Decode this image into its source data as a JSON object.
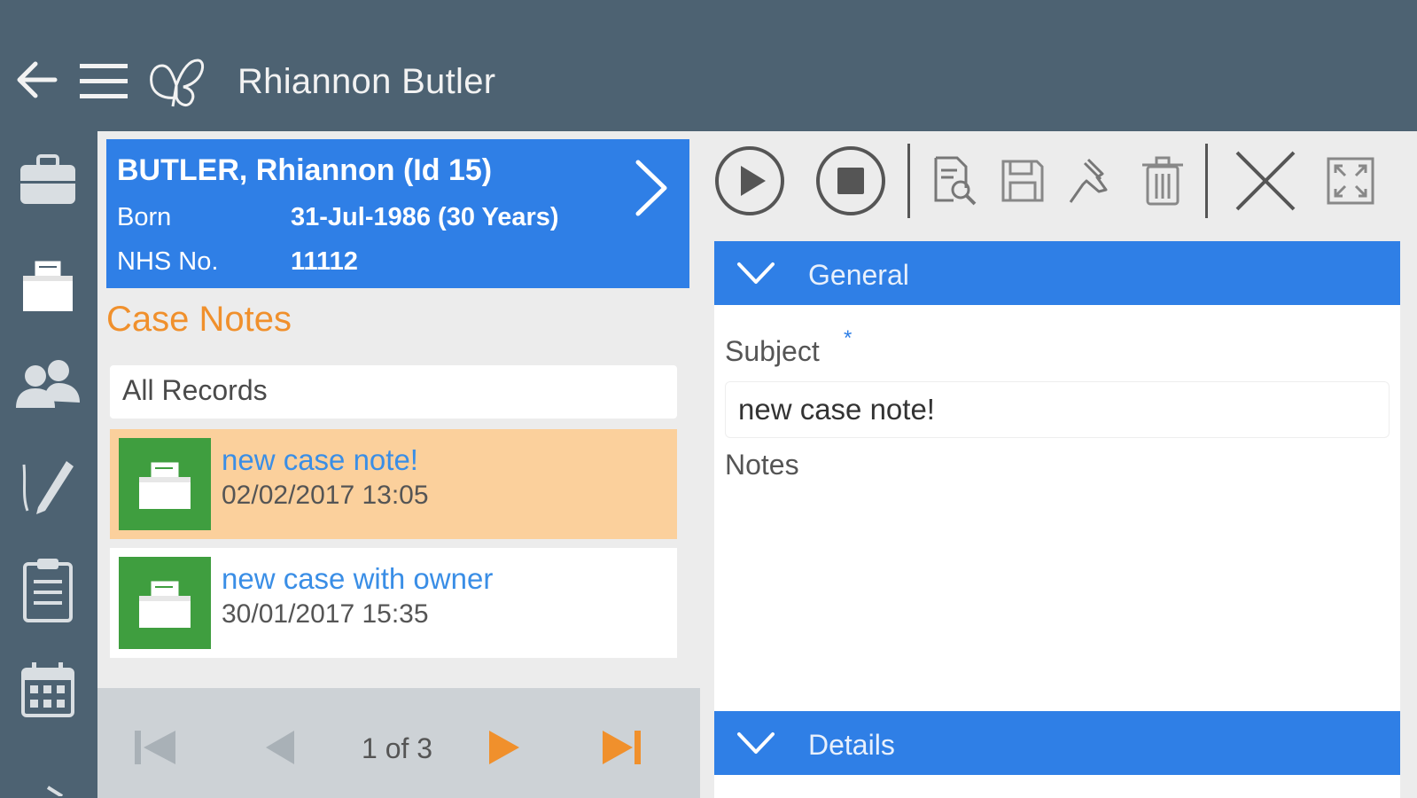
{
  "header": {
    "title": "Rhiannon Butler",
    "back_icon": "back-arrow-icon",
    "menu_icon": "hamburger-menu-icon",
    "logo_icon": "butterfly-logo-icon"
  },
  "sidenav": {
    "items": [
      {
        "icon": "briefcase-icon"
      },
      {
        "icon": "case-notes-icon"
      },
      {
        "icon": "people-icon"
      },
      {
        "icon": "signature-pen-icon"
      },
      {
        "icon": "clipboard-icon"
      },
      {
        "icon": "calendar-icon"
      }
    ]
  },
  "patient": {
    "name": "BUTLER, Rhiannon (Id 15)",
    "born_label": "Born",
    "born_value": "31-Jul-1986 (30 Years)",
    "nhs_label": "NHS No.",
    "nhs_value": "11112"
  },
  "case_notes": {
    "title": "Case Notes",
    "filter": "All Records",
    "records": [
      {
        "title": "new case note!",
        "date": "02/02/2017 13:05",
        "selected": true
      },
      {
        "title": "new case with owner",
        "date": "30/01/2017 15:35",
        "selected": false
      }
    ]
  },
  "pager": {
    "text": "1 of 3"
  },
  "toolbar": {
    "buttons": [
      "play-icon",
      "stop-icon",
      "preview-icon",
      "save-icon",
      "pin-icon",
      "trash-icon",
      "close-icon",
      "fullscreen-icon"
    ]
  },
  "form": {
    "general_label": "General",
    "subject_label": "Subject",
    "required_mark": "*",
    "subject_value": "new case note!",
    "notes_label": "Notes",
    "details_label": "Details"
  },
  "colors": {
    "header_bg": "#4d6272",
    "accent_blue": "#2f7fe6",
    "orange": "#f0902c",
    "selected_row": "#fbd09c",
    "record_icon_green": "#3f9e3f"
  }
}
